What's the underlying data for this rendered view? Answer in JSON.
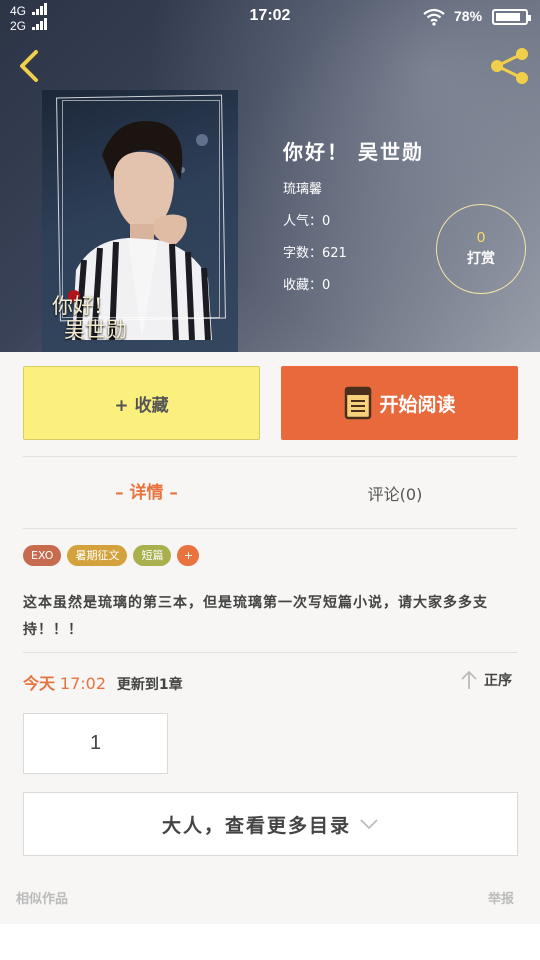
{
  "status_bar": {
    "network_top": "4G",
    "network_bottom": "2G",
    "time": "17:02",
    "battery_percent": "78%",
    "battery_level": 0.78
  },
  "book": {
    "cover_caption_line1": "你好!",
    "cover_caption_line2": "吴世勋",
    "title": "你好！ 吴世勋",
    "author": "琉璃馨",
    "popularity": "人气：0",
    "word_count": "字数：621",
    "favorites": "收藏：0",
    "tip_count": "0",
    "tip_label": "打赏"
  },
  "actions": {
    "favorite_label": "+ 收藏",
    "read_label": "开始阅读"
  },
  "tabs": {
    "detail_label": "– 详情 –",
    "comments_label": "评论(0)"
  },
  "tags": [
    {
      "label": "EXO",
      "color": "#c66b4e"
    },
    {
      "label": "暑期征文",
      "color": "#d4a23c"
    },
    {
      "label": "短篇",
      "color": "#a9b04e"
    },
    {
      "label": "+",
      "color": "#e8733f"
    }
  ],
  "description": "这本虽然是琉璃的第三本，但是琉璃第一次写短篇小说，请大家多多支持！！！",
  "update": {
    "day": "今天",
    "time": "17:02",
    "text": "更新到1章",
    "sort_label": "正序"
  },
  "chapters": {
    "first": "1",
    "more_label": "大人，查看更多目录"
  },
  "footer": {
    "similar_label": "相似作品",
    "report_label": "举报"
  },
  "colors": {
    "accent": "#e8733f",
    "favorite_bg": "#fbf07e",
    "icon_yellow": "#f2cf4a"
  }
}
